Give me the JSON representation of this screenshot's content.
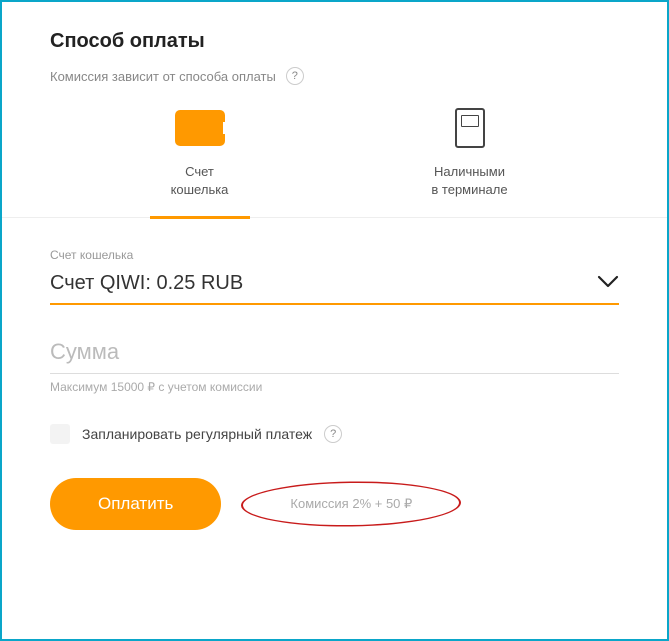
{
  "header": {
    "title": "Способ оплаты",
    "subtitle": "Комиссия зависит от способа оплаты",
    "help": "?"
  },
  "methods": {
    "wallet": {
      "line1": "Счет",
      "line2": "кошелька"
    },
    "cash": {
      "line1": "Наличными",
      "line2": "в терминале"
    }
  },
  "walletSelect": {
    "label": "Счет кошелька",
    "value": "Счет QIWI: 0.25 RUB"
  },
  "amount": {
    "placeholder": "Сумма",
    "hint": "Максимум 15000 ₽ с учетом комиссии"
  },
  "schedule": {
    "label": "Запланировать регулярный платеж",
    "help": "?"
  },
  "actions": {
    "pay": "Оплатить",
    "commission": "Комиссия 2% + 50 ₽"
  }
}
